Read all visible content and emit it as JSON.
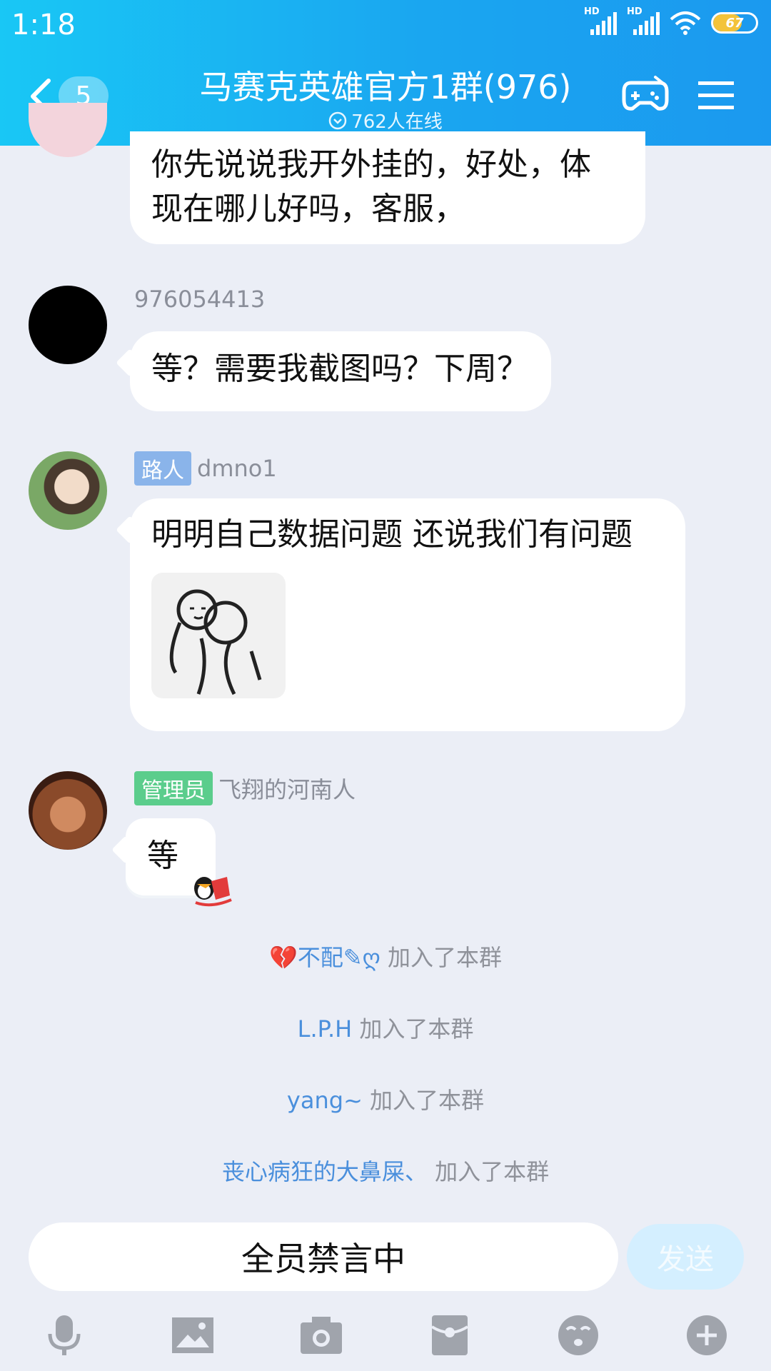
{
  "status_bar": {
    "time": "1:18",
    "battery": "67",
    "battery_level": 0.67
  },
  "header": {
    "unread_count": "5",
    "title": "马赛克英雄官方1群(976)",
    "online": "762人在线"
  },
  "messages": [
    {
      "text_line1": "你先说说我开外挂的，好处，体",
      "text_line2": "现在哪儿好吗，客服，",
      "avatar": "avatar-partial"
    },
    {
      "sender": "976054413",
      "text": "等？需要我截图吗？下周？",
      "avatar": "black-circle"
    },
    {
      "role": "路人",
      "role_color": "#8ab4ea",
      "sender": "dmno1",
      "text": "明明自己数据问题 还说我们有问题",
      "sticker": "hug-meme-sticker"
    },
    {
      "role": "管理员",
      "role_color": "#5bcd8c",
      "sender": "飞翔的河南人",
      "text": "等",
      "avatar": "face-photo"
    }
  ],
  "system": [
    {
      "nick": "💔不配✎ღ",
      "action": "加入了本群"
    },
    {
      "nick": "L.P.H",
      "action": "加入了本群"
    },
    {
      "nick": "yang~",
      "action": "加入了本群"
    },
    {
      "nick": "丧心病狂的大鼻屎、",
      "action": "加入了本群"
    }
  ],
  "input": {
    "value": "全员禁言中",
    "send_label": "发送"
  },
  "toolbar": [
    "microphone-icon",
    "image-icon",
    "camera-icon",
    "red-packet-icon",
    "emoji-icon",
    "plus-icon"
  ],
  "colors": {
    "header_start": "#19c7f5",
    "header_end": "#1b99ef",
    "chat_bg": "#ebeef6",
    "nick_blue": "#4a8fdc"
  }
}
